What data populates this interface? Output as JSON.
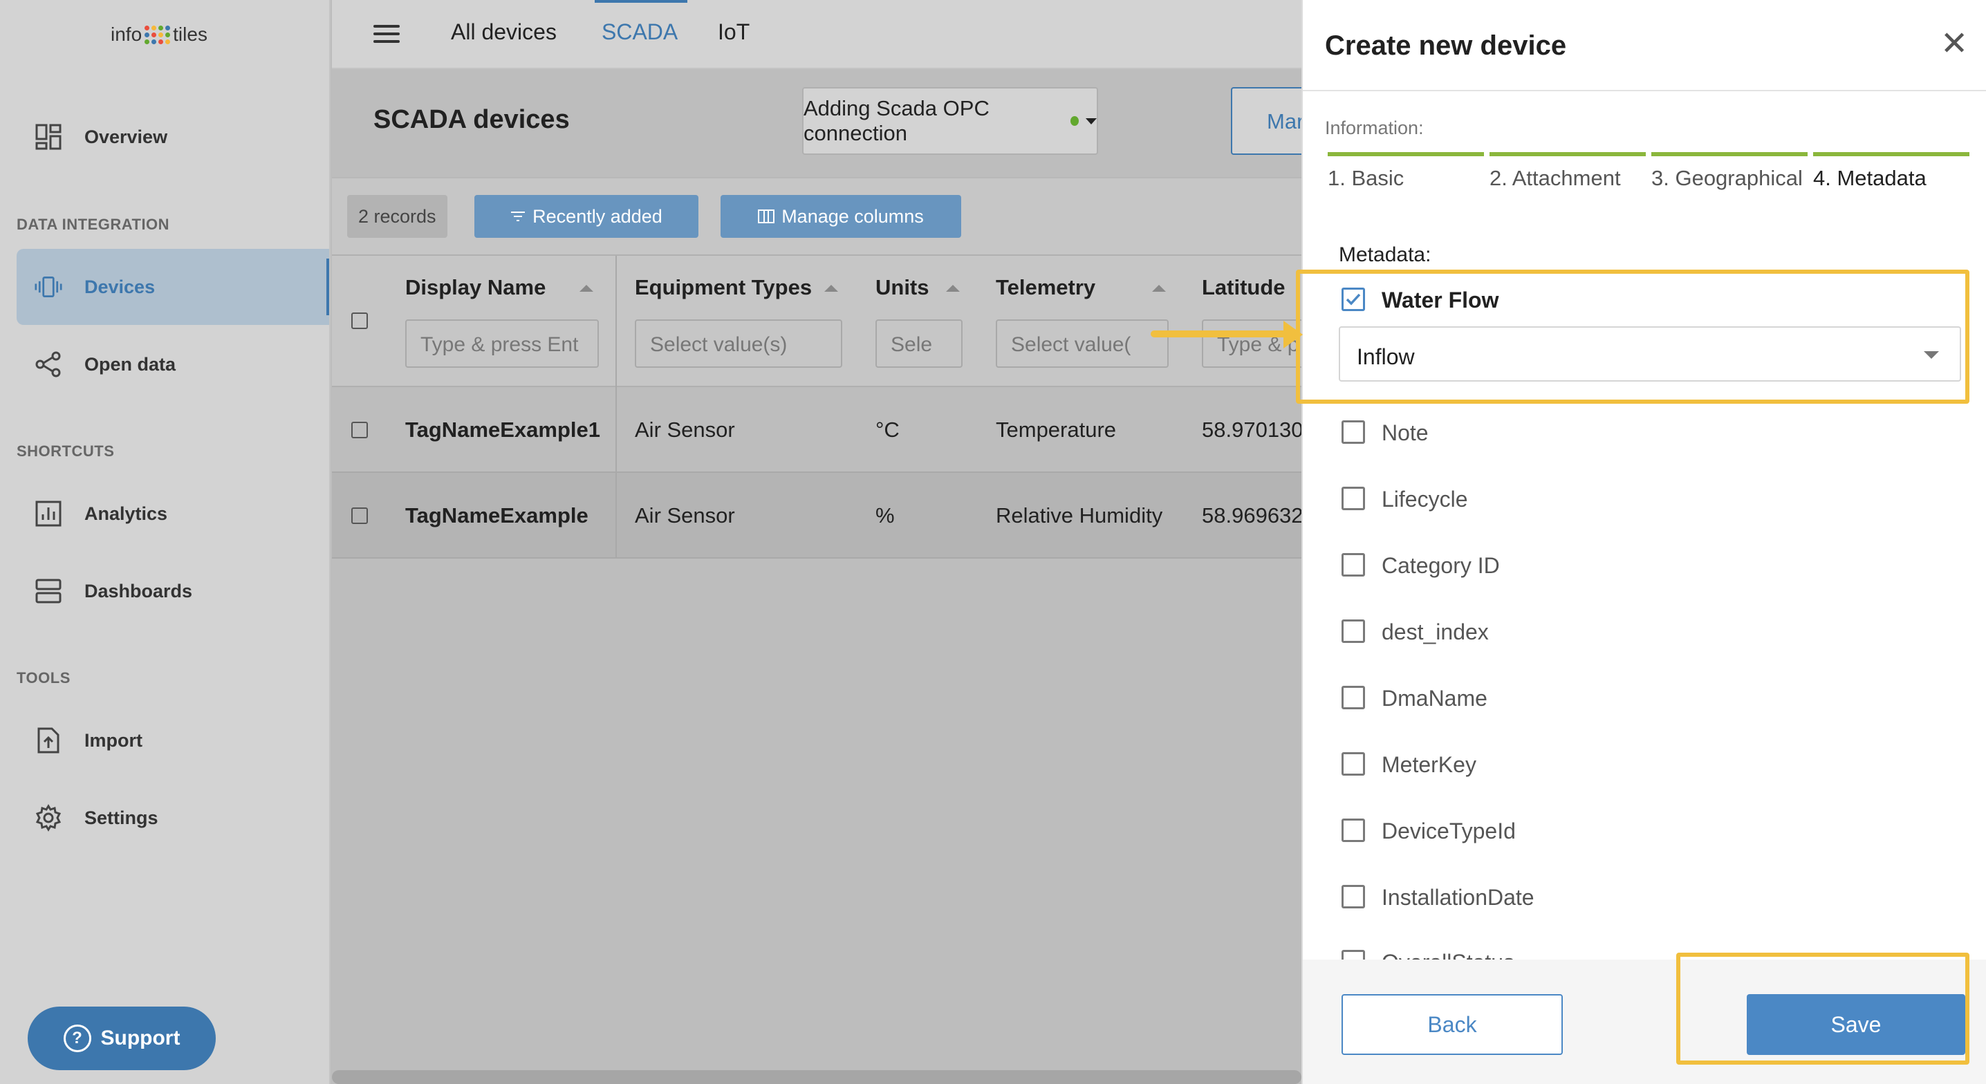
{
  "app": {
    "logo_left": "info",
    "logo_right": "tiles",
    "logo_dot_colors": [
      "#e94e3d",
      "#f6b83a",
      "#62a82e",
      "#3d77ad"
    ]
  },
  "sidebar": {
    "overview": "Overview",
    "section_data_integration": "DATA INTEGRATION",
    "devices": "Devices",
    "open_data": "Open data",
    "section_shortcuts": "SHORTCUTS",
    "analytics": "Analytics",
    "dashboards": "Dashboards",
    "section_tools": "TOOLS",
    "import": "Import",
    "settings": "Settings",
    "support": "Support"
  },
  "topbar": {
    "tabs": [
      "All devices",
      "SCADA",
      "IoT"
    ],
    "active_tab": "SCADA"
  },
  "main": {
    "title": "SCADA devices",
    "opc_button": "Adding Scada OPC connection",
    "opc_status_color": "#62a82e",
    "manage_button_partial": "Mar",
    "records": "2 records",
    "recently_added": "Recently added",
    "manage_columns": "Manage columns"
  },
  "table": {
    "columns": [
      {
        "label": "Display Name",
        "filter": "Type & press Ent"
      },
      {
        "label": "Equipment Types",
        "filter": "Select value(s)"
      },
      {
        "label": "Units",
        "filter": "Sele"
      },
      {
        "label": "Telemetry",
        "filter": "Select value("
      },
      {
        "label": "Latitude",
        "filter": "Type & p"
      }
    ],
    "rows": [
      {
        "name": "TagNameExample1",
        "equipment": "Air Sensor",
        "unit": "°C",
        "telemetry": "Temperature",
        "latitude": "58.970130"
      },
      {
        "name": "TagNameExample",
        "equipment": "Air Sensor",
        "unit": "%",
        "telemetry": "Relative Humidity",
        "latitude": "58.969632"
      }
    ]
  },
  "panel": {
    "title": "Create new device",
    "information_label": "Information:",
    "steps": [
      "1. Basic",
      "2. Attachment",
      "3. Geographical",
      "4. Metadata"
    ],
    "current_step": "4. Metadata",
    "metadata_label": "Metadata:",
    "water_flow": {
      "label": "Water Flow",
      "checked": true,
      "selected": "Inflow"
    },
    "other_fields": [
      "Note",
      "Lifecycle",
      "Category ID",
      "dest_index",
      "DmaName",
      "MeterKey",
      "DeviceTypeId",
      "InstallationDate",
      "OverallStatus"
    ],
    "back": "Back",
    "save": "Save"
  },
  "colors": {
    "accent": "#3d77ad",
    "progress_green": "#8bb73c",
    "highlight": "#f1bf3e"
  }
}
